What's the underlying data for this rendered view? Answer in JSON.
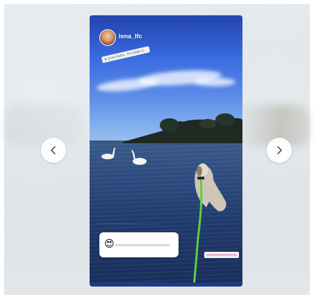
{
  "story": {
    "username": "lena_lfc",
    "mention_text": "♥ CHATTARS, TO-DIMA-S...",
    "hashtag_text": "#SOTOCENTAGRAM",
    "slider_emoji": "😍",
    "slider_value": 0.1
  },
  "navigation": {
    "prev_icon": "chevron-left-icon",
    "next_icon": "chevron-right-icon"
  },
  "colors": {
    "leash": "#5fd13a",
    "slider_track": "#d9d9d9",
    "story_sky": "#2b55d0"
  }
}
